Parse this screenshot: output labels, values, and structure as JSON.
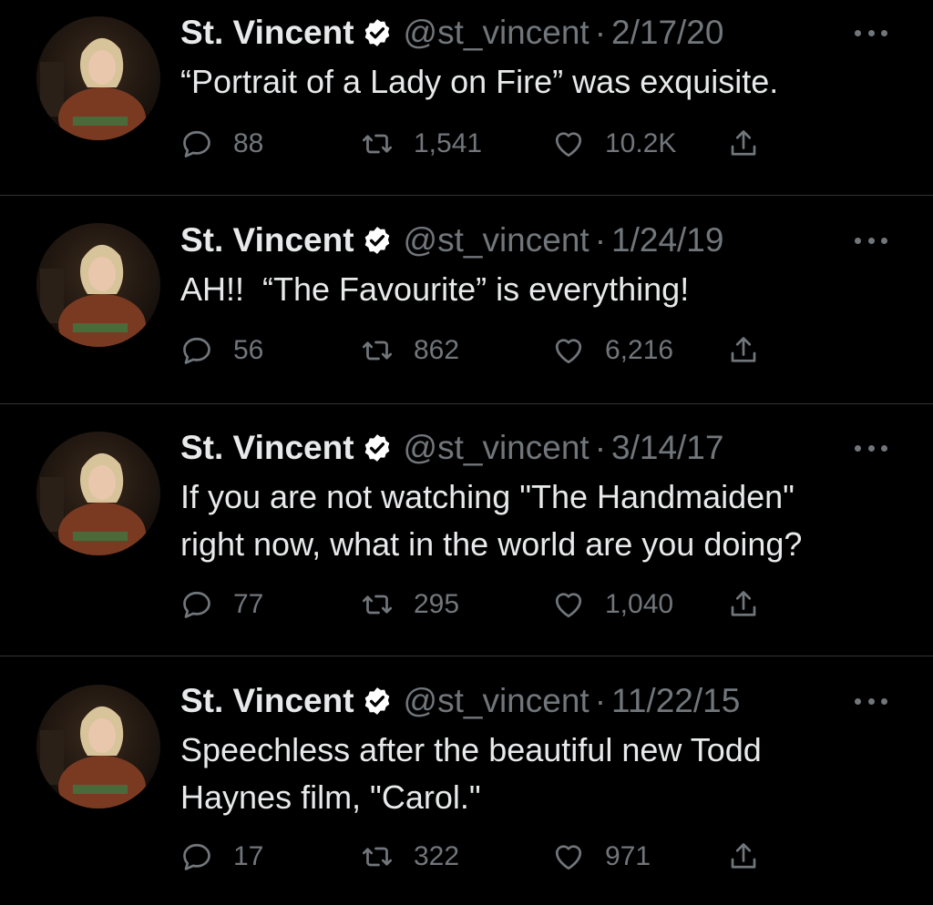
{
  "colors": {
    "background": "#000000",
    "text_primary": "#e7e9ea",
    "text_secondary": "#71767b",
    "divider": "#2f3336",
    "verified_badge": "#ffffff"
  },
  "icons": {
    "reply": "speech-bubble-icon",
    "retweet": "retweet-arrows-icon",
    "like": "heart-outline-icon",
    "share": "share-upload-icon",
    "more": "three-dots-icon",
    "verified": "verified-badge-icon"
  },
  "tweets": [
    {
      "name": "St. Vincent",
      "handle": "@st_vincent",
      "separator": "·",
      "date": "2/17/20",
      "text": "“Portrait of a Lady on Fire” was exquisite.",
      "replies": "88",
      "retweets": "1,541",
      "likes": "10.2K"
    },
    {
      "name": "St. Vincent",
      "handle": "@st_vincent",
      "separator": "·",
      "date": "1/24/19",
      "text": "AH!!  “The Favourite” is everything!",
      "replies": "56",
      "retweets": "862",
      "likes": "6,216"
    },
    {
      "name": "St. Vincent",
      "handle": "@st_vincent",
      "separator": "·",
      "date": "3/14/17",
      "text": "If you are not watching \"The Handmaiden\"\nright now, what in the world are you doing?",
      "replies": "77",
      "retweets": "295",
      "likes": "1,040"
    },
    {
      "name": "St. Vincent",
      "handle": "@st_vincent",
      "separator": "·",
      "date": "11/22/15",
      "text": "Speechless after the beautiful new Todd\nHaynes film, \"Carol.\"",
      "replies": "17",
      "retweets": "322",
      "likes": "971"
    }
  ]
}
